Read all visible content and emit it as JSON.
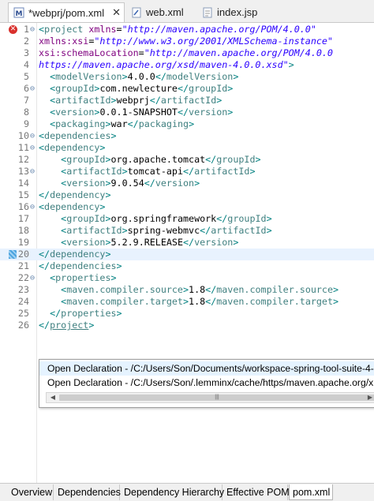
{
  "tabs": [
    {
      "label": "*webprj/pom.xml",
      "icon": "maven-xml-icon",
      "active": true,
      "closable": true
    },
    {
      "label": "web.xml",
      "icon": "xml-file-icon",
      "active": false
    },
    {
      "label": "index.jsp",
      "icon": "jsp-file-icon",
      "active": false
    }
  ],
  "close_glyph": "✕",
  "editor": {
    "lines": [
      {
        "n": "1",
        "fold": "⊖",
        "mark": "error",
        "parts": [
          [
            "br",
            "<"
          ],
          [
            "tag",
            "project"
          ],
          [
            "txt",
            " "
          ],
          [
            "attr",
            "xmlns"
          ],
          [
            "txt",
            "="
          ],
          [
            "val",
            "\"http://maven.apache.org/POM/4.0.0\""
          ]
        ]
      },
      {
        "n": "2",
        "parts": [
          [
            "attr",
            "xmlns:xsi"
          ],
          [
            "txt",
            "="
          ],
          [
            "val",
            "\"http://www.w3.org/2001/XMLSchema-instance\""
          ]
        ]
      },
      {
        "n": "3",
        "parts": [
          [
            "attr",
            "xsi:schemaLocation"
          ],
          [
            "txt",
            "="
          ],
          [
            "val",
            "\"http://maven.apache.org/POM/4.0.0"
          ]
        ]
      },
      {
        "n": "4",
        "parts": [
          [
            "val",
            "https://maven.apache.org/xsd/maven-4.0.0.xsd\""
          ],
          [
            "br",
            ">"
          ]
        ]
      },
      {
        "n": "5",
        "parts": [
          [
            "txt",
            "  "
          ],
          [
            "br",
            "<"
          ],
          [
            "tag",
            "modelVersion"
          ],
          [
            "br",
            ">"
          ],
          [
            "txt",
            "4.0.0"
          ],
          [
            "br",
            "</"
          ],
          [
            "tag",
            "modelVersion"
          ],
          [
            "br",
            ">"
          ]
        ]
      },
      {
        "n": "6",
        "fold": "⊖",
        "parts": [
          [
            "txt",
            "  "
          ],
          [
            "br",
            "<"
          ],
          [
            "tag",
            "groupId"
          ],
          [
            "br",
            ">"
          ],
          [
            "txt",
            "com.newlecture"
          ],
          [
            "br",
            "</"
          ],
          [
            "tag",
            "groupId"
          ],
          [
            "br",
            ">"
          ]
        ]
      },
      {
        "n": "7",
        "parts": [
          [
            "txt",
            "  "
          ],
          [
            "br",
            "<"
          ],
          [
            "tag",
            "artifactId"
          ],
          [
            "br",
            ">"
          ],
          [
            "txt",
            "webprj"
          ],
          [
            "br",
            "</"
          ],
          [
            "tag",
            "artifactId"
          ],
          [
            "br",
            ">"
          ]
        ]
      },
      {
        "n": "8",
        "parts": [
          [
            "txt",
            "  "
          ],
          [
            "br",
            "<"
          ],
          [
            "tag",
            "version"
          ],
          [
            "br",
            ">"
          ],
          [
            "txt",
            "0.0.1-SNAPSHOT"
          ],
          [
            "br",
            "</"
          ],
          [
            "tag",
            "version"
          ],
          [
            "br",
            ">"
          ]
        ]
      },
      {
        "n": "9",
        "parts": [
          [
            "txt",
            "  "
          ],
          [
            "br",
            "<"
          ],
          [
            "tag",
            "packaging"
          ],
          [
            "br",
            ">"
          ],
          [
            "txt",
            "war"
          ],
          [
            "br",
            "</"
          ],
          [
            "tag",
            "packaging"
          ],
          [
            "br",
            ">"
          ]
        ]
      },
      {
        "n": "10",
        "fold": "⊖",
        "parts": [
          [
            "br",
            "<"
          ],
          [
            "tag",
            "dependencies"
          ],
          [
            "br",
            ">"
          ]
        ]
      },
      {
        "n": "11",
        "fold": "⊖",
        "parts": [
          [
            "br",
            "<"
          ],
          [
            "tag",
            "dependency"
          ],
          [
            "br",
            ">"
          ]
        ]
      },
      {
        "n": "12",
        "parts": [
          [
            "txt",
            "    "
          ],
          [
            "br",
            "<"
          ],
          [
            "tag",
            "groupId"
          ],
          [
            "br",
            ">"
          ],
          [
            "txt",
            "org.apache.tomcat"
          ],
          [
            "br",
            "</"
          ],
          [
            "tag",
            "groupId"
          ],
          [
            "br",
            ">"
          ]
        ]
      },
      {
        "n": "13",
        "fold": "⊖",
        "parts": [
          [
            "txt",
            "    "
          ],
          [
            "br",
            "<"
          ],
          [
            "tag",
            "artifactId"
          ],
          [
            "br",
            ">"
          ],
          [
            "txt",
            "tomcat-api"
          ],
          [
            "br",
            "</"
          ],
          [
            "tag",
            "artifactId"
          ],
          [
            "br",
            ">"
          ]
        ]
      },
      {
        "n": "14",
        "parts": [
          [
            "txt",
            "    "
          ],
          [
            "br",
            "<"
          ],
          [
            "tag",
            "version"
          ],
          [
            "br",
            ">"
          ],
          [
            "txt",
            "9.0.54"
          ],
          [
            "br",
            "</"
          ],
          [
            "tag",
            "version"
          ],
          [
            "br",
            ">"
          ]
        ]
      },
      {
        "n": "15",
        "parts": [
          [
            "br",
            "</"
          ],
          [
            "tag",
            "dependency"
          ],
          [
            "br",
            ">"
          ]
        ]
      },
      {
        "n": "16",
        "fold": "⊖",
        "parts": [
          [
            "br",
            "<"
          ],
          [
            "tag",
            "dependency"
          ],
          [
            "br",
            ">"
          ]
        ]
      },
      {
        "n": "17",
        "parts": [
          [
            "txt",
            "    "
          ],
          [
            "br",
            "<"
          ],
          [
            "tag",
            "groupId"
          ],
          [
            "br",
            ">"
          ],
          [
            "txt",
            "org.springframework"
          ],
          [
            "br",
            "</"
          ],
          [
            "tag",
            "groupId"
          ],
          [
            "br",
            ">"
          ]
        ]
      },
      {
        "n": "18",
        "parts": [
          [
            "txt",
            "    "
          ],
          [
            "br",
            "<"
          ],
          [
            "tag",
            "artifactId"
          ],
          [
            "br",
            ">"
          ],
          [
            "txt",
            "spring-webmvc"
          ],
          [
            "br",
            "</"
          ],
          [
            "tag",
            "artifactId"
          ],
          [
            "br",
            ">"
          ]
        ]
      },
      {
        "n": "19",
        "parts": [
          [
            "txt",
            "    "
          ],
          [
            "br",
            "<"
          ],
          [
            "tag",
            "version"
          ],
          [
            "br",
            ">"
          ],
          [
            "txt",
            "5.2.9.RELEASE"
          ],
          [
            "br",
            "</"
          ],
          [
            "tag",
            "version"
          ],
          [
            "br",
            ">"
          ]
        ]
      },
      {
        "n": "20",
        "mark": "quickfix",
        "highlight": true,
        "parts": [
          [
            "br",
            "</"
          ],
          [
            "tag",
            "dependency"
          ],
          [
            "br",
            ">"
          ]
        ]
      },
      {
        "n": "21",
        "parts": [
          [
            "br",
            "</"
          ],
          [
            "tag",
            "dependencies"
          ],
          [
            "br",
            ">"
          ]
        ]
      },
      {
        "n": "22",
        "fold": "⊖",
        "parts": [
          [
            "txt",
            "  "
          ],
          [
            "br",
            "<"
          ],
          [
            "tag",
            "properties"
          ],
          [
            "br",
            ">"
          ]
        ]
      },
      {
        "n": "23",
        "parts": [
          [
            "txt",
            "    "
          ],
          [
            "br",
            "<"
          ],
          [
            "tag",
            "maven.compiler.source"
          ],
          [
            "br",
            ">"
          ],
          [
            "txt",
            "1.8"
          ],
          [
            "br",
            "</"
          ],
          [
            "tag",
            "maven.compiler.source"
          ],
          [
            "br",
            ">"
          ]
        ]
      },
      {
        "n": "24",
        "parts": [
          [
            "txt",
            "    "
          ],
          [
            "br",
            "<"
          ],
          [
            "tag",
            "maven.compiler.target"
          ],
          [
            "br",
            ">"
          ],
          [
            "txt",
            "1.8"
          ],
          [
            "br",
            "</"
          ],
          [
            "tag",
            "maven.compiler.target"
          ],
          [
            "br",
            ">"
          ]
        ]
      },
      {
        "n": "25",
        "parts": [
          [
            "txt",
            "  "
          ],
          [
            "br",
            "</"
          ],
          [
            "tag",
            "properties"
          ],
          [
            "br",
            ">"
          ]
        ]
      },
      {
        "n": "26",
        "parts": [
          [
            "br",
            "</"
          ],
          [
            "tag",
            "project",
            "underline"
          ],
          [
            "br",
            ">"
          ]
        ]
      }
    ]
  },
  "popup": {
    "items": [
      "Open Declaration - /C:/Users/Son/Documents/workspace-spring-tool-suite-4-",
      "Open Declaration - /C:/Users/Son/.lemminx/cache/https/maven.apache.org/x"
    ],
    "scroll_left": "◀",
    "scroll_right": "▶",
    "thumb_grip": "|||"
  },
  "bottom_tabs": [
    "Overview",
    "Dependencies",
    "Dependency Hierarchy",
    "Effective POM",
    "pom.xml"
  ],
  "active_bottom_tab": "pom.xml",
  "colors": {
    "tag": "#3f7f7f",
    "attr": "#7f007f",
    "value": "#2a00ff",
    "highlight": "#e8f2fe"
  }
}
